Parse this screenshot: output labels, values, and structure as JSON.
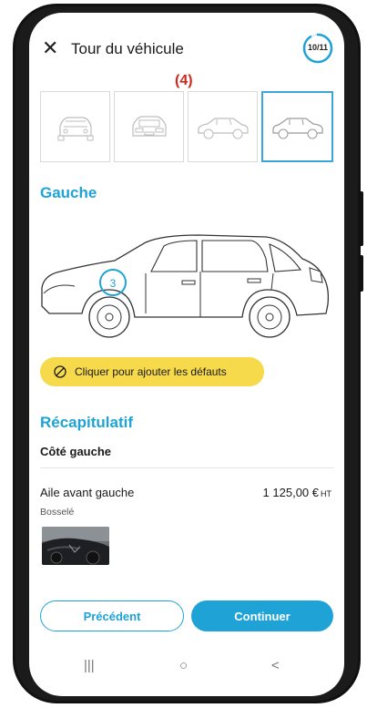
{
  "header": {
    "title": "Tour du véhicule",
    "close_icon": "close-icon",
    "progress_text": "10/11",
    "progress_fraction": 0.909
  },
  "step_label": "(4)",
  "thumbnails": [
    {
      "name": "front-view",
      "active": false
    },
    {
      "name": "rear-view",
      "active": false
    },
    {
      "name": "right-side-view",
      "active": false
    },
    {
      "name": "left-side-view",
      "active": true
    }
  ],
  "section": {
    "title": "Gauche"
  },
  "car": {
    "marker_number": "3"
  },
  "defect_button": {
    "label": "Cliquer pour ajouter les défauts",
    "icon": "tap-icon"
  },
  "recap": {
    "title": "Récapitulatif",
    "side_title": "Côté gauche",
    "item": {
      "name": "Aile avant gauche",
      "price": "1 125,00 €",
      "price_suffix": "HT",
      "status": "Bosselé"
    }
  },
  "buttons": {
    "previous": "Précédent",
    "continue": "Continuer"
  },
  "navbar": {
    "recents": "|||",
    "home": "○",
    "back": "<"
  },
  "colors": {
    "accent": "#1fa3d6",
    "yellow": "#f7d94c",
    "step_red": "#d0271d"
  }
}
